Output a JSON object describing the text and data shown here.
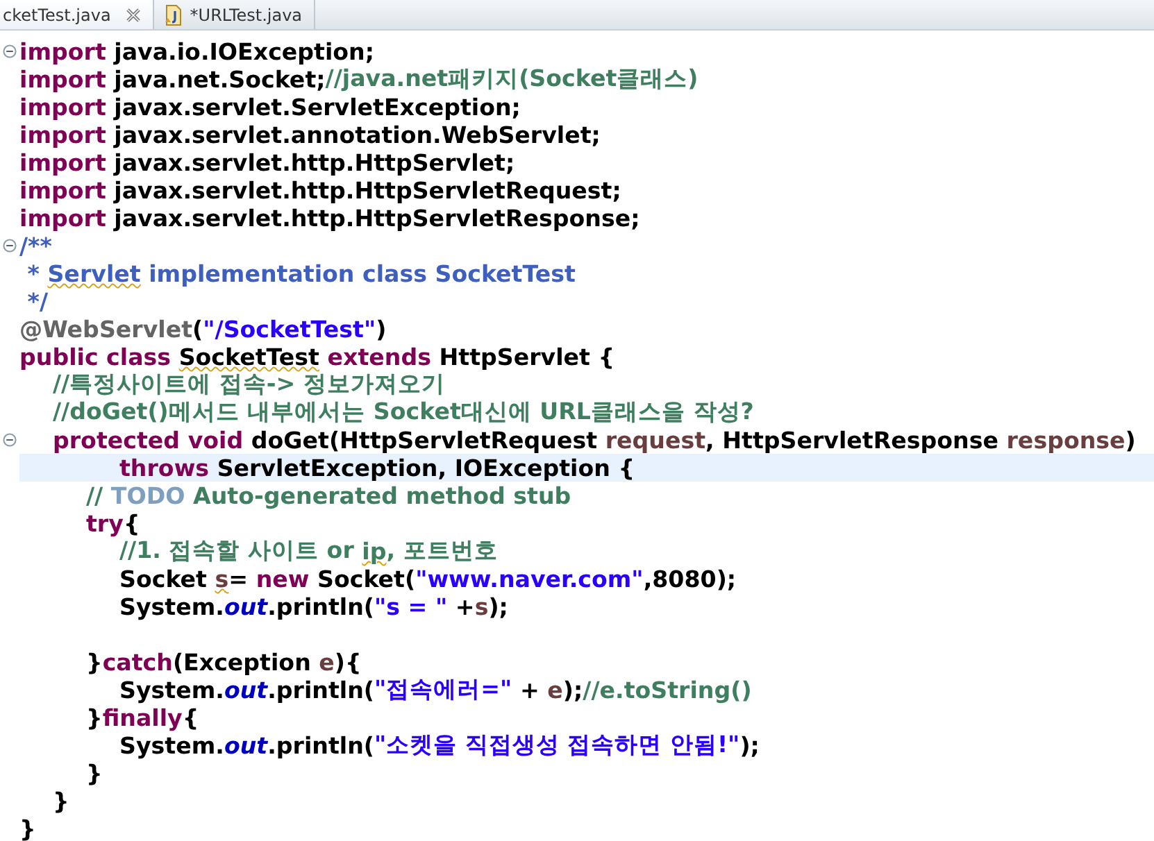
{
  "tabs": [
    {
      "label": "cketTest.java",
      "selected": true,
      "dirty": false,
      "closable": true
    },
    {
      "label": "*URLTest.java",
      "selected": false,
      "dirty": true,
      "closable": false
    }
  ],
  "editor": {
    "lines": [
      {
        "fold": true,
        "current": false,
        "tokens": [
          {
            "kind": "keyword",
            "text": "import"
          },
          {
            "kind": "plain",
            "text": " java.io.IOException;"
          }
        ]
      },
      {
        "fold": false,
        "current": false,
        "tokens": [
          {
            "kind": "keyword",
            "text": "import"
          },
          {
            "kind": "plain",
            "text": " java.net.Socket;"
          },
          {
            "kind": "comment",
            "text": "//java.net패키지(Socket클래스)"
          }
        ]
      },
      {
        "fold": false,
        "current": false,
        "tokens": [
          {
            "kind": "keyword",
            "text": "import"
          },
          {
            "kind": "plain",
            "text": " javax.servlet.ServletException;"
          }
        ]
      },
      {
        "fold": false,
        "current": false,
        "tokens": [
          {
            "kind": "keyword",
            "text": "import"
          },
          {
            "kind": "plain",
            "text": " javax.servlet.annotation.WebServlet;"
          }
        ]
      },
      {
        "fold": false,
        "current": false,
        "tokens": [
          {
            "kind": "keyword",
            "text": "import"
          },
          {
            "kind": "plain",
            "text": " javax.servlet.http.HttpServlet;"
          }
        ]
      },
      {
        "fold": false,
        "current": false,
        "tokens": [
          {
            "kind": "keyword",
            "text": "import"
          },
          {
            "kind": "plain",
            "text": " javax.servlet.http.HttpServletRequest;"
          }
        ]
      },
      {
        "fold": false,
        "current": false,
        "tokens": [
          {
            "kind": "keyword",
            "text": "import"
          },
          {
            "kind": "plain",
            "text": " javax.servlet.http.HttpServletResponse;"
          }
        ]
      },
      {
        "fold": true,
        "current": false,
        "tokens": [
          {
            "kind": "javadoc",
            "text": "/**"
          }
        ]
      },
      {
        "fold": false,
        "current": false,
        "tokens": [
          {
            "kind": "javadoc",
            "text": " * "
          },
          {
            "kind": "javadoc",
            "text": "Servlet",
            "squiggle": true
          },
          {
            "kind": "javadoc",
            "text": " implementation class SocketTest"
          }
        ]
      },
      {
        "fold": false,
        "current": false,
        "tokens": [
          {
            "kind": "javadoc",
            "text": " */"
          }
        ]
      },
      {
        "fold": false,
        "current": false,
        "tokens": [
          {
            "kind": "annotation",
            "text": "@WebServlet"
          },
          {
            "kind": "plain",
            "text": "("
          },
          {
            "kind": "string",
            "text": "\"/SocketTest\""
          },
          {
            "kind": "plain",
            "text": ")"
          }
        ]
      },
      {
        "fold": false,
        "current": false,
        "tokens": [
          {
            "kind": "keyword",
            "text": "public class "
          },
          {
            "kind": "plain",
            "text": "SocketTest",
            "squiggle": true
          },
          {
            "kind": "keyword",
            "text": " extends"
          },
          {
            "kind": "plain",
            "text": " HttpServlet {"
          }
        ]
      },
      {
        "fold": false,
        "current": false,
        "tokens": [
          {
            "kind": "comment",
            "text": "\t//특정사이트에 접속-> 정보가져오기"
          }
        ]
      },
      {
        "fold": false,
        "current": false,
        "tokens": [
          {
            "kind": "comment",
            "text": "\t//doGet()메서드 내부에서는 Socket대신에 URL클래스을 작성?"
          }
        ]
      },
      {
        "fold": true,
        "current": false,
        "tokens": [
          {
            "kind": "keyword",
            "text": "\tprotected void"
          },
          {
            "kind": "plain",
            "text": " doGet(HttpServletRequest "
          },
          {
            "kind": "variable",
            "text": "request"
          },
          {
            "kind": "plain",
            "text": ", HttpServletResponse "
          },
          {
            "kind": "variable",
            "text": "response"
          },
          {
            "kind": "plain",
            "text": ")"
          }
        ]
      },
      {
        "fold": false,
        "current": true,
        "tokens": [
          {
            "kind": "keyword",
            "text": "\t\t\tthrows"
          },
          {
            "kind": "plain",
            "text": " ServletException, IOException {"
          }
        ]
      },
      {
        "fold": false,
        "current": false,
        "tokens": [
          {
            "kind": "comment",
            "text": "\t\t// "
          },
          {
            "kind": "todo",
            "text": "TODO"
          },
          {
            "kind": "comment",
            "text": " Auto-generated method stub"
          }
        ]
      },
      {
        "fold": false,
        "current": false,
        "tokens": [
          {
            "kind": "keyword",
            "text": "\t\ttry"
          },
          {
            "kind": "plain",
            "text": "{"
          }
        ]
      },
      {
        "fold": false,
        "current": false,
        "tokens": [
          {
            "kind": "comment",
            "text": "\t\t\t//1. 접속할 사이트 or "
          },
          {
            "kind": "comment",
            "text": "ip",
            "squiggle": true
          },
          {
            "kind": "comment",
            "text": ", 포트번호"
          }
        ]
      },
      {
        "fold": false,
        "current": false,
        "tokens": [
          {
            "kind": "plain",
            "text": "\t\t\tSocket "
          },
          {
            "kind": "variable",
            "text": "s",
            "squiggle": true
          },
          {
            "kind": "plain",
            "text": "= "
          },
          {
            "kind": "keyword",
            "text": "new"
          },
          {
            "kind": "plain",
            "text": " Socket("
          },
          {
            "kind": "string",
            "text": "\"www.naver.com\""
          },
          {
            "kind": "plain",
            "text": ",8080);"
          }
        ]
      },
      {
        "fold": false,
        "current": false,
        "tokens": [
          {
            "kind": "plain",
            "text": "\t\t\tSystem."
          },
          {
            "kind": "field",
            "text": "out"
          },
          {
            "kind": "plain",
            "text": ".println("
          },
          {
            "kind": "string",
            "text": "\"s = \""
          },
          {
            "kind": "plain",
            "text": " +"
          },
          {
            "kind": "variable",
            "text": "s"
          },
          {
            "kind": "plain",
            "text": ");"
          }
        ]
      },
      {
        "fold": false,
        "current": false
      },
      {
        "fold": false,
        "current": false,
        "tokens": [
          {
            "kind": "plain",
            "text": "\t\t}"
          },
          {
            "kind": "keyword",
            "text": "catch"
          },
          {
            "kind": "plain",
            "text": "(Exception "
          },
          {
            "kind": "variable",
            "text": "e"
          },
          {
            "kind": "plain",
            "text": "){"
          }
        ]
      },
      {
        "fold": false,
        "current": false,
        "tokens": [
          {
            "kind": "plain",
            "text": "\t\t\tSystem."
          },
          {
            "kind": "field",
            "text": "out"
          },
          {
            "kind": "plain",
            "text": ".println("
          },
          {
            "kind": "string",
            "text": "\"접속에러=\""
          },
          {
            "kind": "plain",
            "text": " + "
          },
          {
            "kind": "variable",
            "text": "e"
          },
          {
            "kind": "plain",
            "text": ");"
          },
          {
            "kind": "comment",
            "text": "//e.toString()"
          }
        ]
      },
      {
        "fold": false,
        "current": false,
        "tokens": [
          {
            "kind": "plain",
            "text": "\t\t}"
          },
          {
            "kind": "keyword",
            "text": "finally"
          },
          {
            "kind": "plain",
            "text": "{"
          }
        ]
      },
      {
        "fold": false,
        "current": false,
        "tokens": [
          {
            "kind": "plain",
            "text": "\t\t\tSystem."
          },
          {
            "kind": "field",
            "text": "out"
          },
          {
            "kind": "plain",
            "text": ".println("
          },
          {
            "kind": "string",
            "text": "\"소켓을 직접생성 접속하면 안됨!\""
          },
          {
            "kind": "plain",
            "text": ");"
          }
        ]
      },
      {
        "fold": false,
        "current": false,
        "tokens": [
          {
            "kind": "plain",
            "text": "\t\t}"
          }
        ]
      },
      {
        "fold": false,
        "current": false,
        "tokens": [
          {
            "kind": "plain",
            "text": "\t}"
          }
        ]
      },
      {
        "fold": false,
        "current": false,
        "tokens": [
          {
            "kind": "plain",
            "text": "}"
          }
        ]
      }
    ]
  }
}
